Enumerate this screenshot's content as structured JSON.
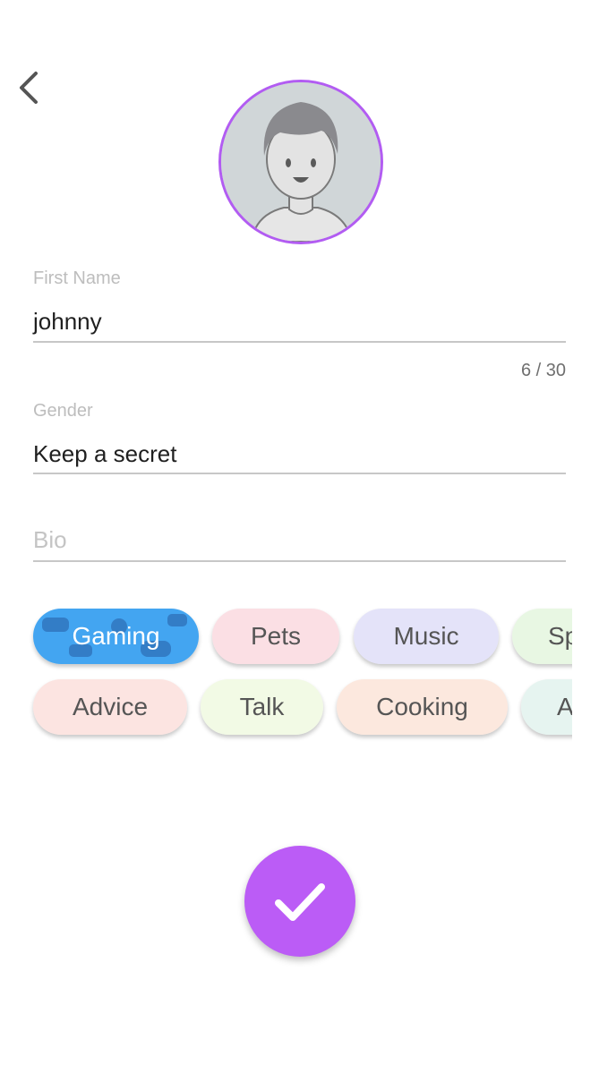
{
  "header": {
    "back_icon": "chevron-left-icon"
  },
  "avatar": {
    "icon": "user-avatar-icon",
    "accent": "#b25cf2"
  },
  "form": {
    "first_name": {
      "label": "First Name",
      "value": "johnny",
      "counter": "6 / 30"
    },
    "gender": {
      "label": "Gender",
      "value": "Keep a secret"
    },
    "bio": {
      "placeholder": "Bio",
      "value": ""
    }
  },
  "interests": [
    {
      "label": "Gaming",
      "selected": true,
      "color": "#2f9cf0"
    },
    {
      "label": "Pets",
      "selected": false,
      "color": "#f6b9c4"
    },
    {
      "label": "Music",
      "selected": false,
      "color": "#c4c0f2"
    },
    {
      "label": "Sp",
      "selected": false,
      "color": "#cdeec1"
    },
    {
      "label": "Advice",
      "selected": false,
      "color": "#f8c3bd"
    },
    {
      "label": "Talk",
      "selected": false,
      "color": "#e2f5c6"
    },
    {
      "label": "Cooking",
      "selected": false,
      "color": "#f8cbb6"
    },
    {
      "label": "A",
      "selected": false,
      "color": "#c8e6de"
    }
  ],
  "submit": {
    "icon": "checkmark-icon",
    "color": "#bb5cf6"
  }
}
